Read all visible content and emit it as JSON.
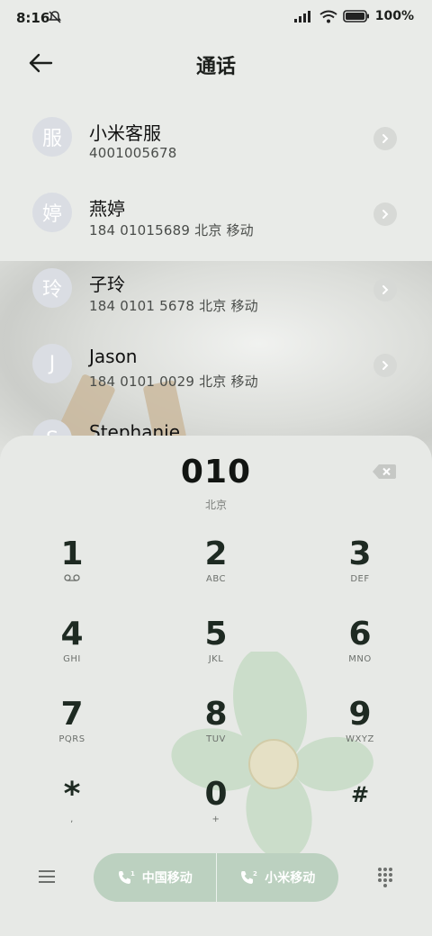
{
  "status_bar": {
    "time": "8:16",
    "battery": "100%"
  },
  "header": {
    "title": "通话"
  },
  "contacts": [
    {
      "avatar": "服",
      "name": "小米客服",
      "number": "4001005678"
    },
    {
      "avatar": "婷",
      "name": "燕婷",
      "number": "184 01015689  北京 移动"
    },
    {
      "avatar": "玲",
      "name": "子玲",
      "number": "184 0101 5678  北京 移动"
    },
    {
      "avatar": "J",
      "name": "Jason",
      "number": "184 0101 0029  北京 移动"
    },
    {
      "avatar": "S",
      "name": "Stephanie",
      "number": ""
    }
  ],
  "dialer": {
    "input": "010",
    "location": "北京",
    "keys": [
      {
        "num": "1",
        "sub": "voicemail-icon"
      },
      {
        "num": "2",
        "sub": "ABC"
      },
      {
        "num": "3",
        "sub": "DEF"
      },
      {
        "num": "4",
        "sub": "GHI"
      },
      {
        "num": "5",
        "sub": "JKL"
      },
      {
        "num": "6",
        "sub": "MNO"
      },
      {
        "num": "7",
        "sub": "PQRS"
      },
      {
        "num": "8",
        "sub": "TUV"
      },
      {
        "num": "9",
        "sub": "WXYZ"
      },
      {
        "num": "*",
        "sub": ","
      },
      {
        "num": "0",
        "sub": "+"
      },
      {
        "num": "#",
        "sub": ""
      }
    ]
  },
  "call_buttons": {
    "sim1": {
      "label": "中国移动",
      "slot": "1"
    },
    "sim2": {
      "label": "小米移动",
      "slot": "2"
    }
  },
  "colors": {
    "call_pill": "#bcd1c0",
    "panel": "#e7e9e6"
  }
}
